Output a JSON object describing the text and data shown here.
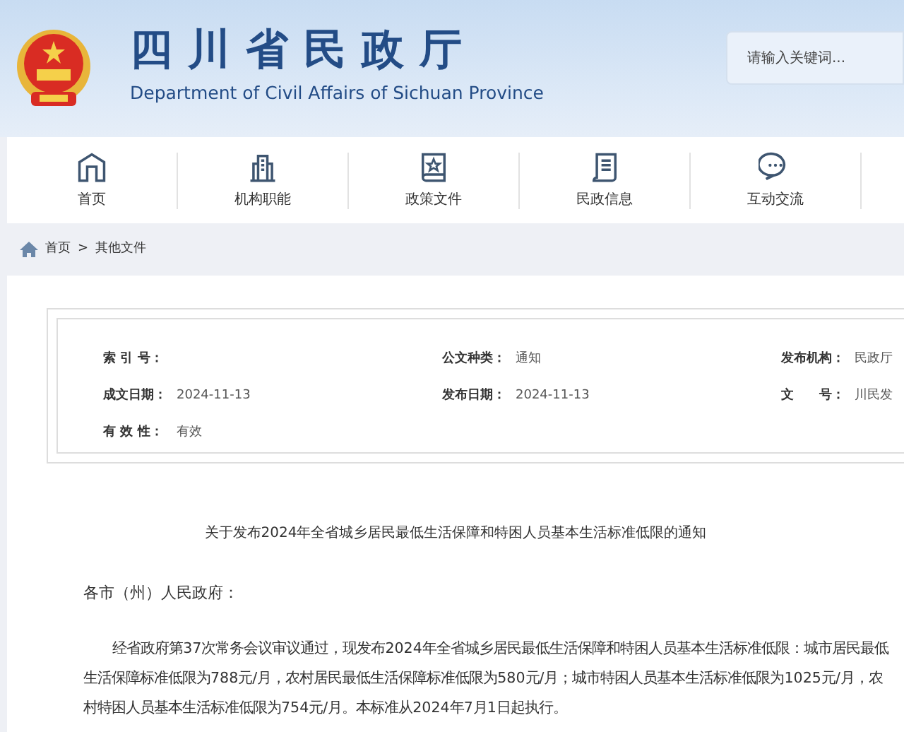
{
  "header": {
    "title": "四川省民政厅",
    "subtitle": "Department of Civil Affairs of Sichuan Province",
    "search": {
      "placeholder": "请输入关键词..."
    }
  },
  "nav": [
    {
      "label": "首页",
      "selected": false
    },
    {
      "label": "机构职能",
      "selected": false
    },
    {
      "label": "政策文件",
      "selected": false
    },
    {
      "label": "民政信息",
      "selected": false
    },
    {
      "label": "互动交流",
      "selected": false
    }
  ],
  "breadcrumb": {
    "items": [
      "首页",
      "其他文件"
    ],
    "separator": ">"
  },
  "meta": [
    [
      {
        "label": "索 引 号："
      },
      {
        "label": "公文种类：",
        "value": "通知"
      },
      {
        "label": "发布机构：",
        "value": "民政厅"
      }
    ],
    [
      {
        "label": "成文日期：",
        "value": "2024-11-13"
      },
      {
        "label": "发布日期：",
        "value": "2024-11-13"
      },
      {
        "label": "文　　号：",
        "value": "川民发"
      }
    ],
    [
      {
        "label": "有 效 性：",
        "value": "有效"
      }
    ]
  ],
  "document": {
    "title": "关于发布2024年全省城乡居民最低生活保障和特困人员基本生活标准低限的通知",
    "salutation": "各市（州）人民政府：",
    "paragraphs": [
      "经省政府第37次常务会议审议通过，现发布2024年全省城乡居民最低生活保障和特困人员基本生活标准低限：城市居民最低生活保障标准低限为788元/月，农村居民最低生活保障标准低限为580元/月；城市特困人员基本生活标准低限为1025元/月，农村特困人员基本生活标准低限为754元/月。本标准从2024年7月1日起执行。"
    ]
  }
}
